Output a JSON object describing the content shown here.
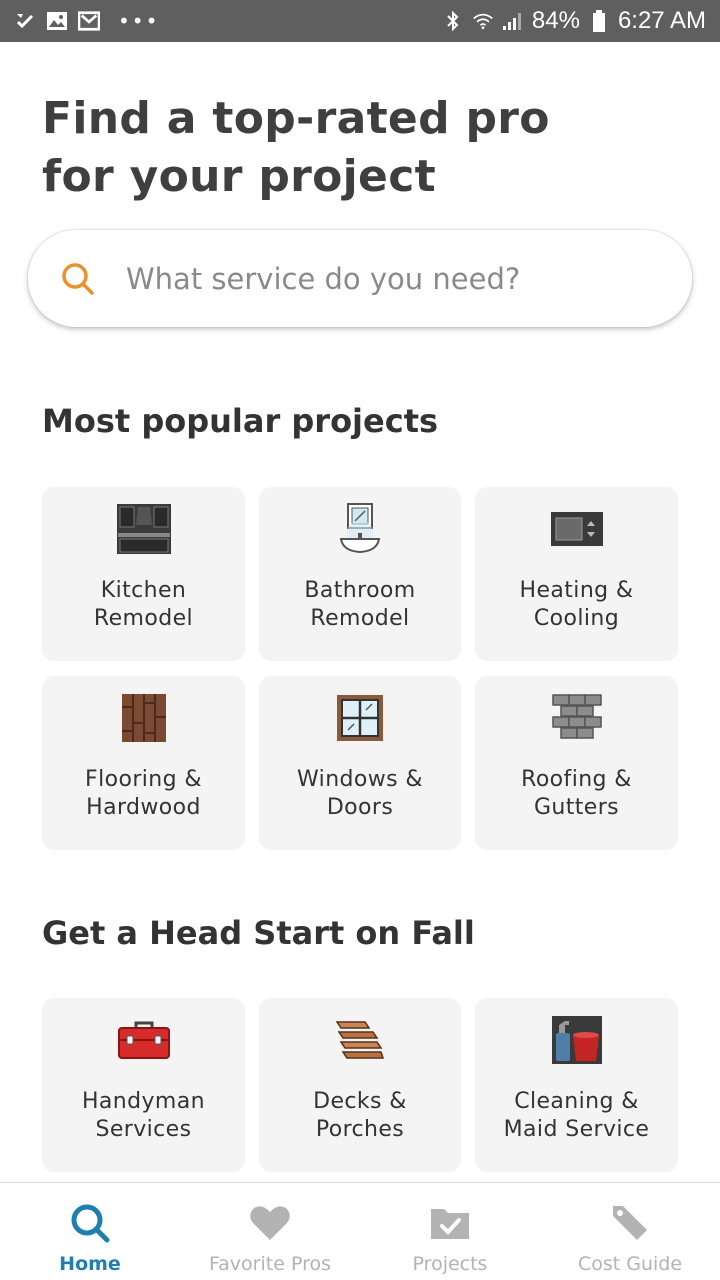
{
  "status_bar": {
    "battery": "84%",
    "time": "6:27 AM",
    "left_icons": [
      "check-notification-icon",
      "image-notification-icon",
      "email-notification-icon"
    ],
    "right_icons": [
      "bluetooth-icon",
      "wifi-icon",
      "signal-icon",
      "battery-icon"
    ]
  },
  "hero": {
    "title_line1": "Find a top-rated pro",
    "title_line2": "for your project"
  },
  "search": {
    "placeholder": "What service do you need?"
  },
  "popular": {
    "title": "Most popular projects",
    "items": [
      {
        "line1": "Kitchen",
        "line2": "Remodel",
        "icon": "kitchen-icon"
      },
      {
        "line1": "Bathroom",
        "line2": "Remodel",
        "icon": "bathroom-icon"
      },
      {
        "line1": "Heating &",
        "line2": "Cooling",
        "icon": "thermostat-icon"
      },
      {
        "line1": "Flooring &",
        "line2": "Hardwood",
        "icon": "flooring-icon"
      },
      {
        "line1": "Windows &",
        "line2": "Doors",
        "icon": "window-icon"
      },
      {
        "line1": "Roofing &",
        "line2": "Gutters",
        "icon": "roof-icon"
      }
    ]
  },
  "fall": {
    "title": "Get a Head Start on Fall",
    "items": [
      {
        "line1": "Handyman",
        "line2": "Services",
        "icon": "toolbox-icon"
      },
      {
        "line1": "Decks &",
        "line2": "Porches",
        "icon": "deck-icon"
      },
      {
        "line1": "Cleaning &",
        "line2": "Maid Service",
        "icon": "cleaning-icon"
      }
    ]
  },
  "bottom_nav": [
    {
      "label": "Home",
      "icon": "search-icon",
      "active": true
    },
    {
      "label": "Favorite Pros",
      "icon": "heart-icon",
      "active": false
    },
    {
      "label": "Projects",
      "icon": "folder-check-icon",
      "active": false
    },
    {
      "label": "Cost Guide",
      "icon": "tag-icon",
      "active": false
    }
  ],
  "colors": {
    "status_bar": "#5f5f5f",
    "search_icon": "#e8912d",
    "nav_active": "#1f7fb0",
    "nav_inactive": "#b3b3b3",
    "card_bg": "#f4f4f4"
  }
}
